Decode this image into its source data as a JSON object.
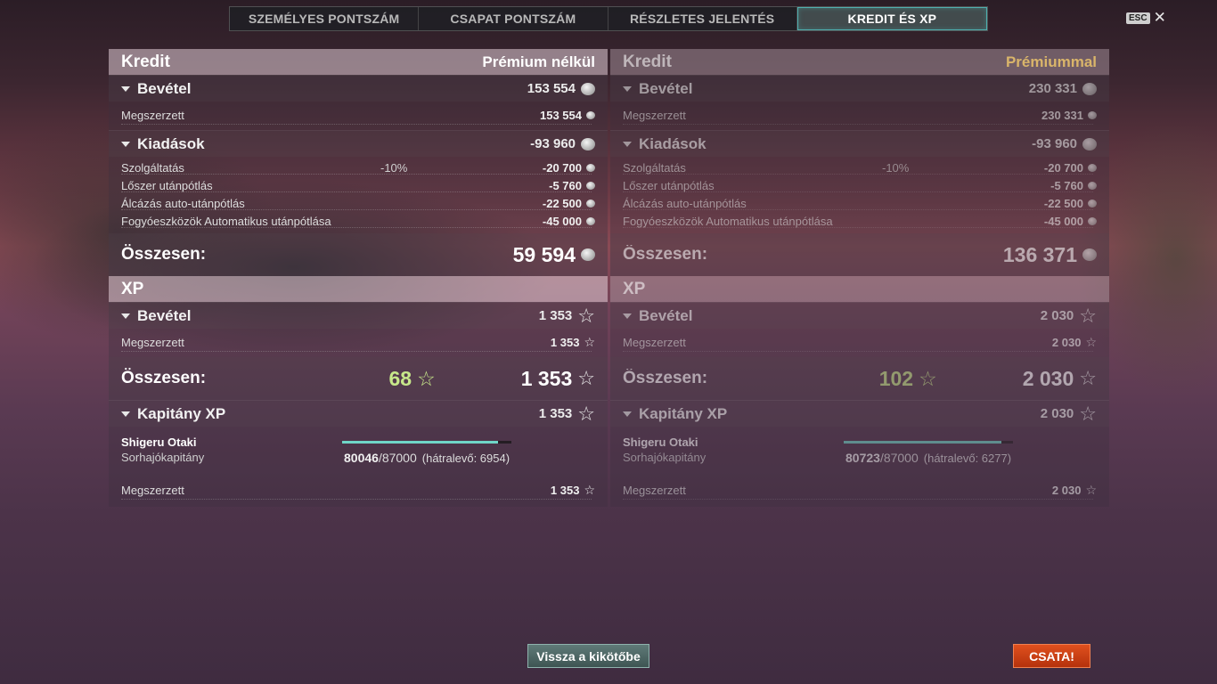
{
  "tabs": [
    {
      "label": "SZEMÉLYES PONTSZÁM",
      "active": false
    },
    {
      "label": "CSAPAT PONTSZÁM",
      "active": false
    },
    {
      "label": "RÉSZLETES JELENTÉS",
      "active": false
    },
    {
      "label": "KREDIT ÉS XP",
      "active": true
    }
  ],
  "esc": {
    "key": "ESC",
    "close": "✕"
  },
  "left": {
    "credit_title": "Kredit",
    "credit_sub": "Prémium nélkül",
    "income_label": "Bevétel",
    "income_value": "153 554",
    "earned_label": "Megszerzett",
    "earned_value": "153 554",
    "expenses_label": "Kiadások",
    "expenses_value": "-93 960",
    "expenses": [
      {
        "label": "Szolgáltatás",
        "pct": "-10%",
        "value": "-20 700"
      },
      {
        "label": "Lőszer utánpótlás",
        "pct": "",
        "value": "-5 760"
      },
      {
        "label": "Álcázás auto-utánpótlás",
        "pct": "",
        "value": "-22 500"
      },
      {
        "label": "Fogyóeszközök Automatikus utánpótlása",
        "pct": "",
        "value": "-45 000"
      }
    ],
    "total_label": "Összesen:",
    "total_credit": "59 594",
    "xp_title": "XP",
    "xp_income_label": "Bevétel",
    "xp_income_value": "1 353",
    "xp_earned_label": "Megszerzett",
    "xp_earned_value": "1 353",
    "xp_total_label": "Összesen:",
    "xp_bonus": "68",
    "xp_total": "1 353",
    "captain_label": "Kapitány XP",
    "captain_value": "1 353",
    "captain_name": "Shigeru Otaki",
    "captain_rank": "Sorhajókapitány",
    "captain_progress_current": "80046",
    "captain_progress_max": "/87000",
    "captain_remaining": "(hátralevő: 6954)",
    "captain_progress_fraction": 0.92,
    "captain_earned_label": "Megszerzett",
    "captain_earned_value": "1 353"
  },
  "right": {
    "credit_title": "Kredit",
    "credit_sub": "Prémiummal",
    "income_label": "Bevétel",
    "income_value": "230 331",
    "earned_label": "Megszerzett",
    "earned_value": "230 331",
    "expenses_label": "Kiadások",
    "expenses_value": "-93 960",
    "expenses": [
      {
        "label": "Szolgáltatás",
        "pct": "-10%",
        "value": "-20 700"
      },
      {
        "label": "Lőszer utánpótlás",
        "pct": "",
        "value": "-5 760"
      },
      {
        "label": "Álcázás auto-utánpótlás",
        "pct": "",
        "value": "-22 500"
      },
      {
        "label": "Fogyóeszközök Automatikus utánpótlása",
        "pct": "",
        "value": "-45 000"
      }
    ],
    "total_label": "Összesen:",
    "total_credit": "136 371",
    "xp_title": "XP",
    "xp_income_label": "Bevétel",
    "xp_income_value": "2 030",
    "xp_earned_label": "Megszerzett",
    "xp_earned_value": "2 030",
    "xp_total_label": "Összesen:",
    "xp_bonus": "102",
    "xp_total": "2 030",
    "captain_label": "Kapitány XP",
    "captain_value": "2 030",
    "captain_name": "Shigeru Otaki",
    "captain_rank": "Sorhajókapitány",
    "captain_progress_current": "80723",
    "captain_progress_max": "/87000",
    "captain_remaining": "(hátralevő: 6277)",
    "captain_progress_fraction": 0.93,
    "captain_earned_label": "Megszerzett",
    "captain_earned_value": "2 030"
  },
  "buttons": {
    "back": "Vissza a kikötőbe",
    "battle": "CSATA!"
  },
  "icons": {
    "credit": "credit-coin-icon",
    "xp": "xp-star-icon"
  }
}
